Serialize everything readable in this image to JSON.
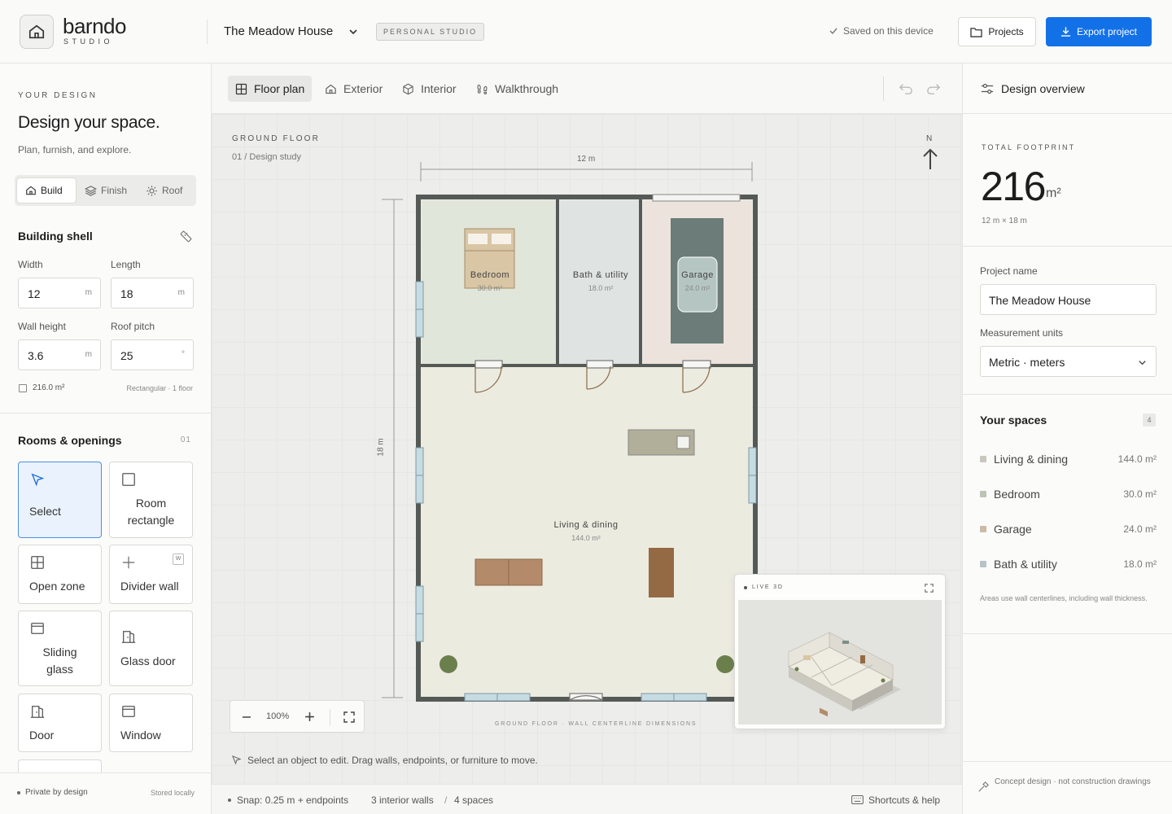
{
  "header": {
    "brand": "barndo",
    "brand_sub": "STUDIO",
    "project_title": "The Meadow House",
    "badge": "PERSONAL STUDIO",
    "saved_status": "Saved on this device",
    "projects_label": "Projects",
    "export_label": "Export project"
  },
  "left": {
    "eyebrow": "YOUR DESIGN",
    "heading": "Design your space.",
    "subheading": "Plan, furnish, and explore.",
    "modes": [
      {
        "label": "Build",
        "icon": "home-icon",
        "active": true
      },
      {
        "label": "Finish",
        "icon": "layers-icon",
        "active": false
      },
      {
        "label": "Roof",
        "icon": "sun-icon",
        "active": false
      }
    ],
    "shell": {
      "title": "Building shell",
      "width_label": "Width",
      "width_value": "12",
      "width_unit": "m",
      "length_label": "Length",
      "length_value": "18",
      "length_unit": "m",
      "wall_height_label": "Wall height",
      "wall_height_value": "3.6",
      "wall_height_unit": "m",
      "roof_pitch_label": "Roof pitch",
      "roof_pitch_value": "25",
      "roof_pitch_unit": "°",
      "area": "216.0 m²",
      "shape_note": "Rectangular · 1 floor"
    },
    "rooms": {
      "title": "Rooms & openings",
      "count": "01",
      "tools": [
        {
          "label": "Select",
          "icon": "cursor-icon"
        },
        {
          "label": "Room rectangle",
          "icon": "square-icon"
        },
        {
          "label": "Open zone",
          "icon": "grid-icon"
        },
        {
          "label": "Divider wall",
          "icon": "plus-icon",
          "key": "W"
        },
        {
          "label": "Sliding glass",
          "icon": "window-icon"
        },
        {
          "label": "Glass door",
          "icon": "glass-door-icon"
        },
        {
          "label": "Door",
          "icon": "door-icon"
        },
        {
          "label": "Window",
          "icon": "window-icon"
        }
      ]
    },
    "footer": {
      "private": "Private by design",
      "stored": "Stored locally"
    }
  },
  "toolbar": {
    "tabs": [
      {
        "label": "Floor plan",
        "icon": "grid-icon",
        "active": true
      },
      {
        "label": "Exterior",
        "icon": "home-icon",
        "active": false
      },
      {
        "label": "Interior",
        "icon": "cube-icon",
        "active": false
      },
      {
        "label": "Walkthrough",
        "icon": "footprints-icon",
        "active": false
      }
    ]
  },
  "canvas": {
    "floor_label": "GROUND FLOOR",
    "floor_sub": "01 / Design study",
    "width_dim": "12 m",
    "length_dim": "18 m",
    "north": "N",
    "rooms": [
      {
        "name": "Bedroom",
        "area": "30.0 m²"
      },
      {
        "name": "Bath & utility",
        "area": "18.0 m²"
      },
      {
        "name": "Garage",
        "area": "24.0 m²"
      },
      {
        "name": "Living & dining",
        "area": "144.0 m²"
      }
    ],
    "footer_note": "GROUND FLOOR · WALL CENTERLINE DIMENSIONS",
    "zoom": "100%",
    "live3d_label": "LIVE 3D",
    "hint": "Select an object to edit. Drag walls, endpoints, or furniture to move."
  },
  "status": {
    "snap": "Snap: 0.25 m + endpoints",
    "walls": "3 interior walls",
    "sep": "/",
    "spaces": "4 spaces",
    "shortcuts": "Shortcuts & help"
  },
  "right": {
    "title": "Design overview",
    "footprint_label": "TOTAL FOOTPRINT",
    "footprint_value": "216",
    "footprint_unit": "m²",
    "footprint_dims": "12 m × 18 m",
    "project_name_label": "Project name",
    "project_name_value": "The Meadow House",
    "units_label": "Measurement units",
    "units_value": "Metric · meters",
    "spaces_title": "Your spaces",
    "spaces_count": "4",
    "spaces": [
      {
        "name": "Living & dining",
        "area": "144.0 m²",
        "color": "#c9c7bd"
      },
      {
        "name": "Bedroom",
        "area": "30.0 m²",
        "color": "#bcc4b4"
      },
      {
        "name": "Garage",
        "area": "24.0 m²",
        "color": "#cdb9a8"
      },
      {
        "name": "Bath & utility",
        "area": "18.0 m²",
        "color": "#b8c3c6"
      }
    ],
    "spaces_note": "Areas use wall centerlines, including wall thickness.",
    "footer_note": "Concept design · not construction drawings"
  }
}
